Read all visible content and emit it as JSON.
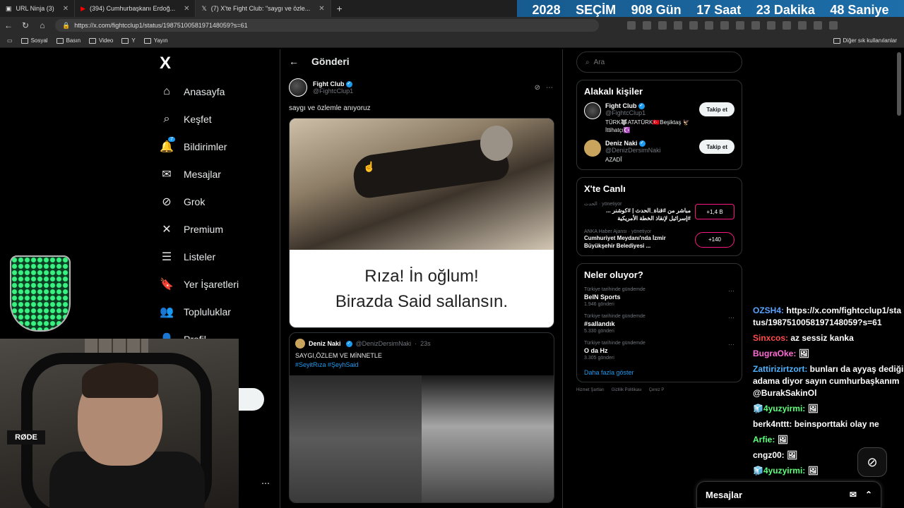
{
  "browser": {
    "tabs": [
      {
        "icon": "url-ninja-icon",
        "title": "URL Ninja (3)"
      },
      {
        "icon": "youtube-icon",
        "title": "(394) Cumhurbaşkanı Erdoğ..."
      },
      {
        "icon": "x-icon",
        "title": "(7) X'te Fight Club: \"saygı ve özle..."
      }
    ],
    "url": "https://x.com/fightcclup1/status/1987510058197148059?s=61",
    "bookmarks": [
      "Sosyal",
      "Basın",
      "Video",
      "Y",
      "Yayın"
    ],
    "bookmarks_other": "Diğer sık kullanılanlar"
  },
  "countdown": {
    "year": "2028",
    "label": "SEÇİM",
    "days": "908 Gün",
    "hours": "17 Saat",
    "minutes": "23 Dakika",
    "seconds": "48 Saniye"
  },
  "nav": {
    "logo": "X",
    "notification_count": "7",
    "items": [
      {
        "label": "Anasayfa",
        "icon": "home-icon"
      },
      {
        "label": "Keşfet",
        "icon": "search-icon"
      },
      {
        "label": "Bildirimler",
        "icon": "bell-icon"
      },
      {
        "label": "Mesajlar",
        "icon": "mail-icon"
      },
      {
        "label": "Grok",
        "icon": "grok-icon"
      },
      {
        "label": "Premium",
        "icon": "x-icon"
      },
      {
        "label": "Listeler",
        "icon": "list-icon"
      },
      {
        "label": "Yer İşaretleri",
        "icon": "bookmark-icon"
      },
      {
        "label": "Topluluklar",
        "icon": "people-icon"
      },
      {
        "label": "Profil",
        "icon": "person-icon"
      }
    ]
  },
  "post": {
    "header": "Gönderi",
    "author_name": "Fight Club",
    "author_handle": "@FightcClup1",
    "text": "saygı ve özlemle anıyoruz",
    "caption_line1": "Rıza! İn oğlum!",
    "caption_line2": "Birazda Said sallansın.",
    "quote": {
      "author_name": "Deniz Naki",
      "author_handle": "@DenizDersimNaki",
      "time": "23s",
      "text_line1": "SAYGI,ÖZLEM VE MİNNETLE",
      "text_line2": "#SeyitRıza #ŞeyhSaid"
    }
  },
  "sidebar": {
    "search_placeholder": "Ara",
    "related_title": "Alakalı kişiler",
    "follow_label": "Takip et",
    "people": [
      {
        "name": "Fight Club",
        "handle": "@FightcClup1",
        "bio": "TÜRK🐺ATATÜRK🇹🇷Beşiktaş 🦅 İttihatçı☪️"
      },
      {
        "name": "Deniz Naki",
        "handle": "@DenizDersimNaki",
        "bio": "AZADÎ"
      }
    ],
    "live_title": "X'te Canlı",
    "live": [
      {
        "source": "الحدث",
        "status": "yönetiyor",
        "text": "مباشر من #قناة_الحدث | #كوشنر ... #إسرائيل لإنقاذ الخطة الأمريكية",
        "count": "+1,4 B"
      },
      {
        "source": "ANKA Haber Ajansı",
        "status": "yönetiyor",
        "text": "Cumhuriyet Meydanı'nda İzmir Büyükşehir Belediyesi ...",
        "count": "+140"
      }
    ],
    "trends_title": "Neler oluyor?",
    "trends": [
      {
        "meta": "Türkiye tarihinde gündemde",
        "topic": "BeIN Sports",
        "count": "1.946 gönderi"
      },
      {
        "meta": "Türkiye tarihinde gündemde",
        "topic": "#sallandık",
        "count": "5.330 gönderi"
      },
      {
        "meta": "Türkiye tarihinde gündemde",
        "topic": "O da Hz",
        "count": "3.305 gönderi"
      }
    ],
    "show_more": "Daha fazla göster",
    "footer": [
      "Hizmet Şartları",
      "Gizlilik Politikası",
      "Çerez P"
    ]
  },
  "messages_dock": {
    "label": "Mesajlar"
  },
  "stream_chat": [
    {
      "user": "OZSH4:",
      "color": "#5aa3ff",
      "text": "https://x.com/fightcclup1/status/1987510058197148059?s=61"
    },
    {
      "user": "Sinxcos:",
      "color": "#ff4b4b",
      "text": "az sessiz kanka"
    },
    {
      "user": "BugraOke:",
      "color": "#ff6bd6",
      "text": "🖼"
    },
    {
      "user": "Zattirizirtzort:",
      "color": "#4fb3ff",
      "text": "bunları da ayyaş dediği adama diyor sayın cumhurbaşkanım @BurakSakinOl"
    },
    {
      "user": "🧊4yuzyirmi:",
      "color": "#5cff7a",
      "text": "🖼"
    },
    {
      "user": "berk4nttt:",
      "color": "#ffffff",
      "text": "beinsporttaki olay ne"
    },
    {
      "user": "Arfie:",
      "color": "#5cff7a",
      "text": "🖼"
    },
    {
      "user": "cngz00:",
      "color": "#ffffff",
      "text": "🖼"
    },
    {
      "user": "🧊4yuzyirmi:",
      "color": "#5cff7a",
      "text": "🖼"
    }
  ],
  "webcam": {
    "mic_brand": "RØDE"
  }
}
